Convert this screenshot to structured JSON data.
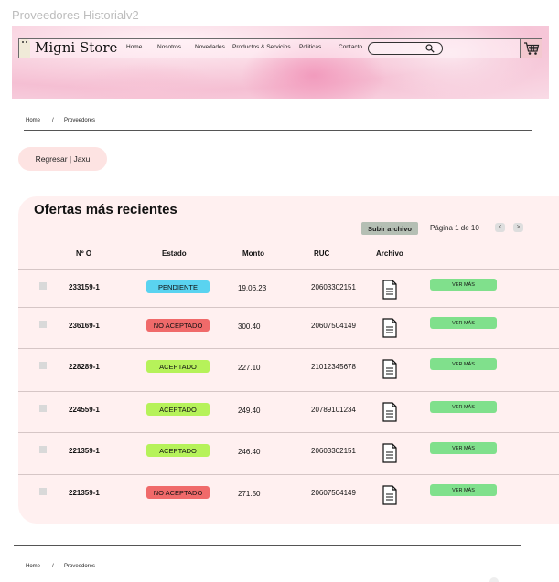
{
  "frame_title": "Proveedores-Historialv2",
  "header": {
    "logo": "Migni Store",
    "nav": [
      "Home",
      "Nosotros",
      "Novedades",
      "Productos & Servicios",
      "Politicas",
      "Contacto"
    ],
    "search_placeholder": "",
    "cart_icon": "cart-icon"
  },
  "breadcrumb": {
    "home": "Home",
    "sep": "/",
    "current": "Proveedores"
  },
  "back_button": "Regresar | Jaxu",
  "offers": {
    "title": "Ofertas más recientes",
    "upload_label": "Subir archivo",
    "page_label": "Página 1 de 10",
    "prev": "<",
    "next": ">",
    "columns": [
      "Nº O",
      "Estado",
      "Monto",
      "RUC",
      "Archivo"
    ],
    "rows": [
      {
        "num": "233159-1",
        "status": "PENDIENTE",
        "amount": "19.06.23",
        "ruc": "20603302151",
        "action": "VER MÁS"
      },
      {
        "num": "236169-1",
        "status": "NO ACEPTADO",
        "amount": "300.40",
        "ruc": "20607504149",
        "action": "VER MÁS"
      },
      {
        "num": "228289-1",
        "status": "ACEPTADO",
        "amount": "227.10",
        "ruc": "21012345678",
        "action": "VER MÁS"
      },
      {
        "num": "224559-1",
        "status": "ACEPTADO",
        "amount": "249.40",
        "ruc": "20789101234",
        "action": "VER MÁS"
      },
      {
        "num": "221359-1",
        "status": "ACEPTADO",
        "amount": "246.40",
        "ruc": "20603302151",
        "action": "VER MÁS"
      },
      {
        "num": "221359-1",
        "status": "NO ACEPTADO",
        "amount": "271.50",
        "ruc": "20607504149",
        "action": "VER MÁS"
      }
    ]
  },
  "status_colors": {
    "PENDIENTE": "#5ad3f0",
    "NO ACEPTADO": "#f06a6a",
    "ACEPTADO": "#b6f25a"
  },
  "footer_breadcrumb": {
    "home": "Home",
    "sep": "/",
    "current": "Proveedores"
  }
}
